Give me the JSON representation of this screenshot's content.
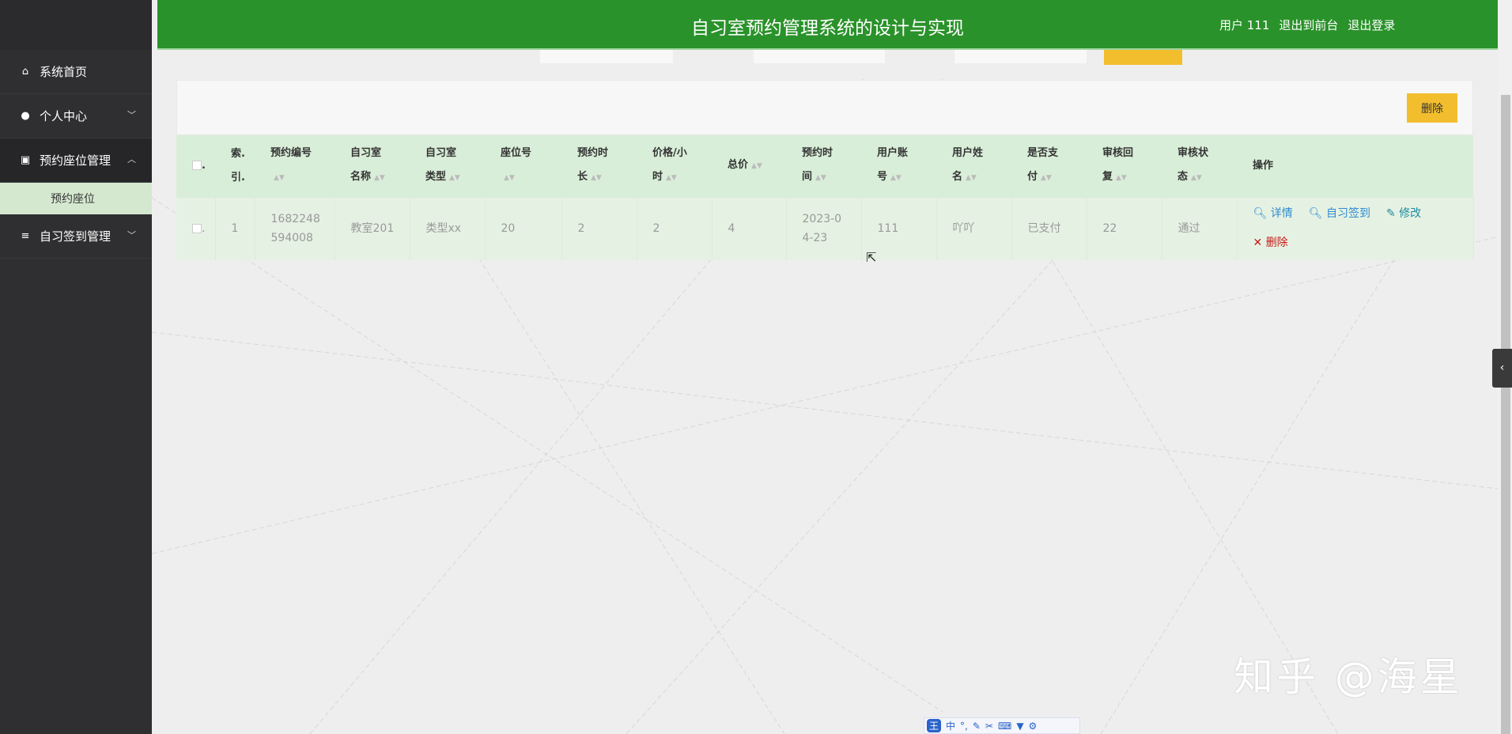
{
  "header": {
    "title": "自习室预约管理系统的设计与实现",
    "user": "用户 111",
    "front": "退出到前台",
    "logout": "退出登录"
  },
  "sidebar": {
    "items": [
      {
        "label": "系统首页",
        "icon": "home-icon"
      },
      {
        "label": "个人中心",
        "icon": "user-icon"
      },
      {
        "label": "预约座位管理",
        "icon": "clipboard-icon"
      },
      {
        "label": "自习签到管理",
        "icon": "list-icon"
      }
    ],
    "sub": "预约座位"
  },
  "toolbar": {
    "delete": "删除"
  },
  "table": {
    "headers": [
      [
        "索.",
        "引."
      ],
      [
        "预约编号",
        ""
      ],
      [
        "自习室",
        "名称"
      ],
      [
        "自习室",
        "类型"
      ],
      [
        "座位号",
        ""
      ],
      [
        "预约时",
        "长"
      ],
      [
        "价格/小",
        "时"
      ],
      [
        "总价",
        ""
      ],
      [
        "预约时",
        "间"
      ],
      [
        "用户账",
        "号"
      ],
      [
        "用户姓",
        "名"
      ],
      [
        "是否支",
        "付"
      ],
      [
        "审核回",
        "复"
      ],
      [
        "审核状",
        "态"
      ],
      [
        "操作",
        ""
      ]
    ],
    "rows": [
      {
        "index": "1",
        "no1": "1682248",
        "no2": "594008",
        "room": "教室201",
        "type": "类型xx",
        "seat": "20",
        "duration": "2",
        "price": "2",
        "total": "4",
        "time1": "2023-0",
        "time2": "4-23",
        "account": "111",
        "name": "吖吖",
        "paid": "已支付",
        "reply": "22",
        "status": "通过"
      }
    ],
    "actions": {
      "detail": "详情",
      "checkin": "自习签到",
      "edit": "修改",
      "delete": "删除"
    }
  },
  "watermark": "知乎 @海星",
  "ime": {
    "w": "王",
    "zh": "中"
  }
}
